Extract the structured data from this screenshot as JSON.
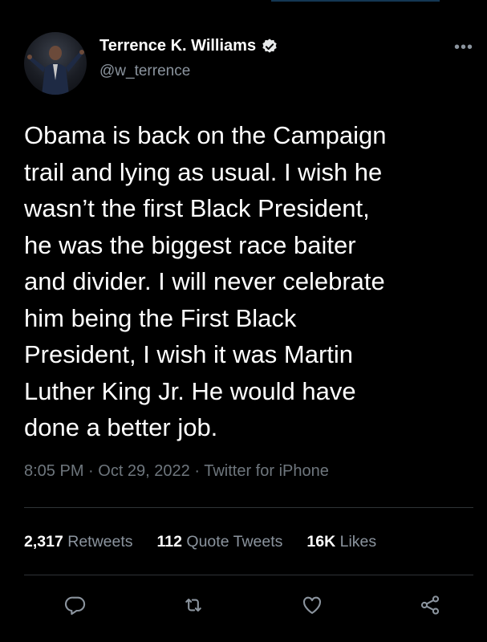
{
  "user": {
    "name": "Terrence K. Williams",
    "handle": "@w_terrence",
    "verified": true
  },
  "more_icon": "more-dots-icon",
  "tweet": {
    "text": "Obama is back on the Campaign\ntrail and lying as usual. I wish he\nwasn’t the first Black President,\nhe was the biggest race baiter\nand divider. I will never celebrate\nhim being the First Black\nPresident, I wish it was Martin\nLuther King Jr. He would have\ndone a better job."
  },
  "meta": {
    "time": "8:05 PM",
    "date": "Oct 29, 2022",
    "source": "Twitter for iPhone",
    "separator": " · "
  },
  "stats": {
    "retweets": {
      "count": "2,317",
      "label": "Retweets"
    },
    "quotes": {
      "count": "112",
      "label": "Quote Tweets"
    },
    "likes": {
      "count": "16K",
      "label": "Likes"
    }
  },
  "actions": [
    "reply-icon",
    "retweet-icon",
    "like-icon",
    "share-icon"
  ],
  "colors": {
    "background": "#000000",
    "text": "#ffffff",
    "muted": "#6e767d",
    "divider": "#2f3336"
  }
}
